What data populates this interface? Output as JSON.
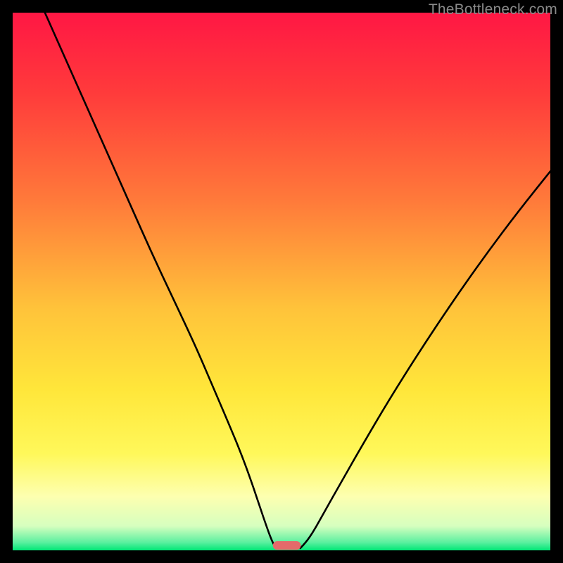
{
  "watermark": "TheBottleneck.com",
  "chart_data": {
    "type": "line",
    "title": "",
    "xlabel": "",
    "ylabel": "",
    "xlim": [
      0,
      100
    ],
    "ylim": [
      0,
      100
    ],
    "background_gradient_stops": [
      {
        "pos": 0.0,
        "color": "#ff1744"
      },
      {
        "pos": 0.15,
        "color": "#ff3b3b"
      },
      {
        "pos": 0.35,
        "color": "#ff7a3a"
      },
      {
        "pos": 0.55,
        "color": "#ffc33a"
      },
      {
        "pos": 0.7,
        "color": "#ffe63a"
      },
      {
        "pos": 0.82,
        "color": "#fff85a"
      },
      {
        "pos": 0.9,
        "color": "#fdffb0"
      },
      {
        "pos": 0.955,
        "color": "#d6ffbf"
      },
      {
        "pos": 0.985,
        "color": "#5cf0a0"
      },
      {
        "pos": 1.0,
        "color": "#00e676"
      }
    ],
    "series": [
      {
        "name": "left-curve",
        "x": [
          6,
          10,
          14,
          18,
          22,
          26,
          30,
          34,
          37,
          40,
          42.5,
          44.5,
          46,
          47.2,
          48,
          48.6,
          49
        ],
        "y": [
          100,
          91,
          82,
          73,
          64,
          55,
          46.5,
          38,
          31,
          24,
          18,
          12.5,
          8,
          4.5,
          2.3,
          1.0,
          0.4
        ]
      },
      {
        "name": "right-curve",
        "x": [
          53.5,
          54.5,
          56,
          58,
          61,
          65,
          70,
          76,
          82,
          88,
          94,
          100
        ],
        "y": [
          0.4,
          1.4,
          3.6,
          7.2,
          12.5,
          19.5,
          28,
          37.5,
          46.5,
          55,
          63,
          70.5
        ]
      }
    ],
    "marker": {
      "name": "bottom-marker",
      "x_center": 51.0,
      "y_center": 0.9,
      "width": 5.2,
      "height": 1.6,
      "rx": 0.8,
      "color": "#e46a6a"
    }
  }
}
